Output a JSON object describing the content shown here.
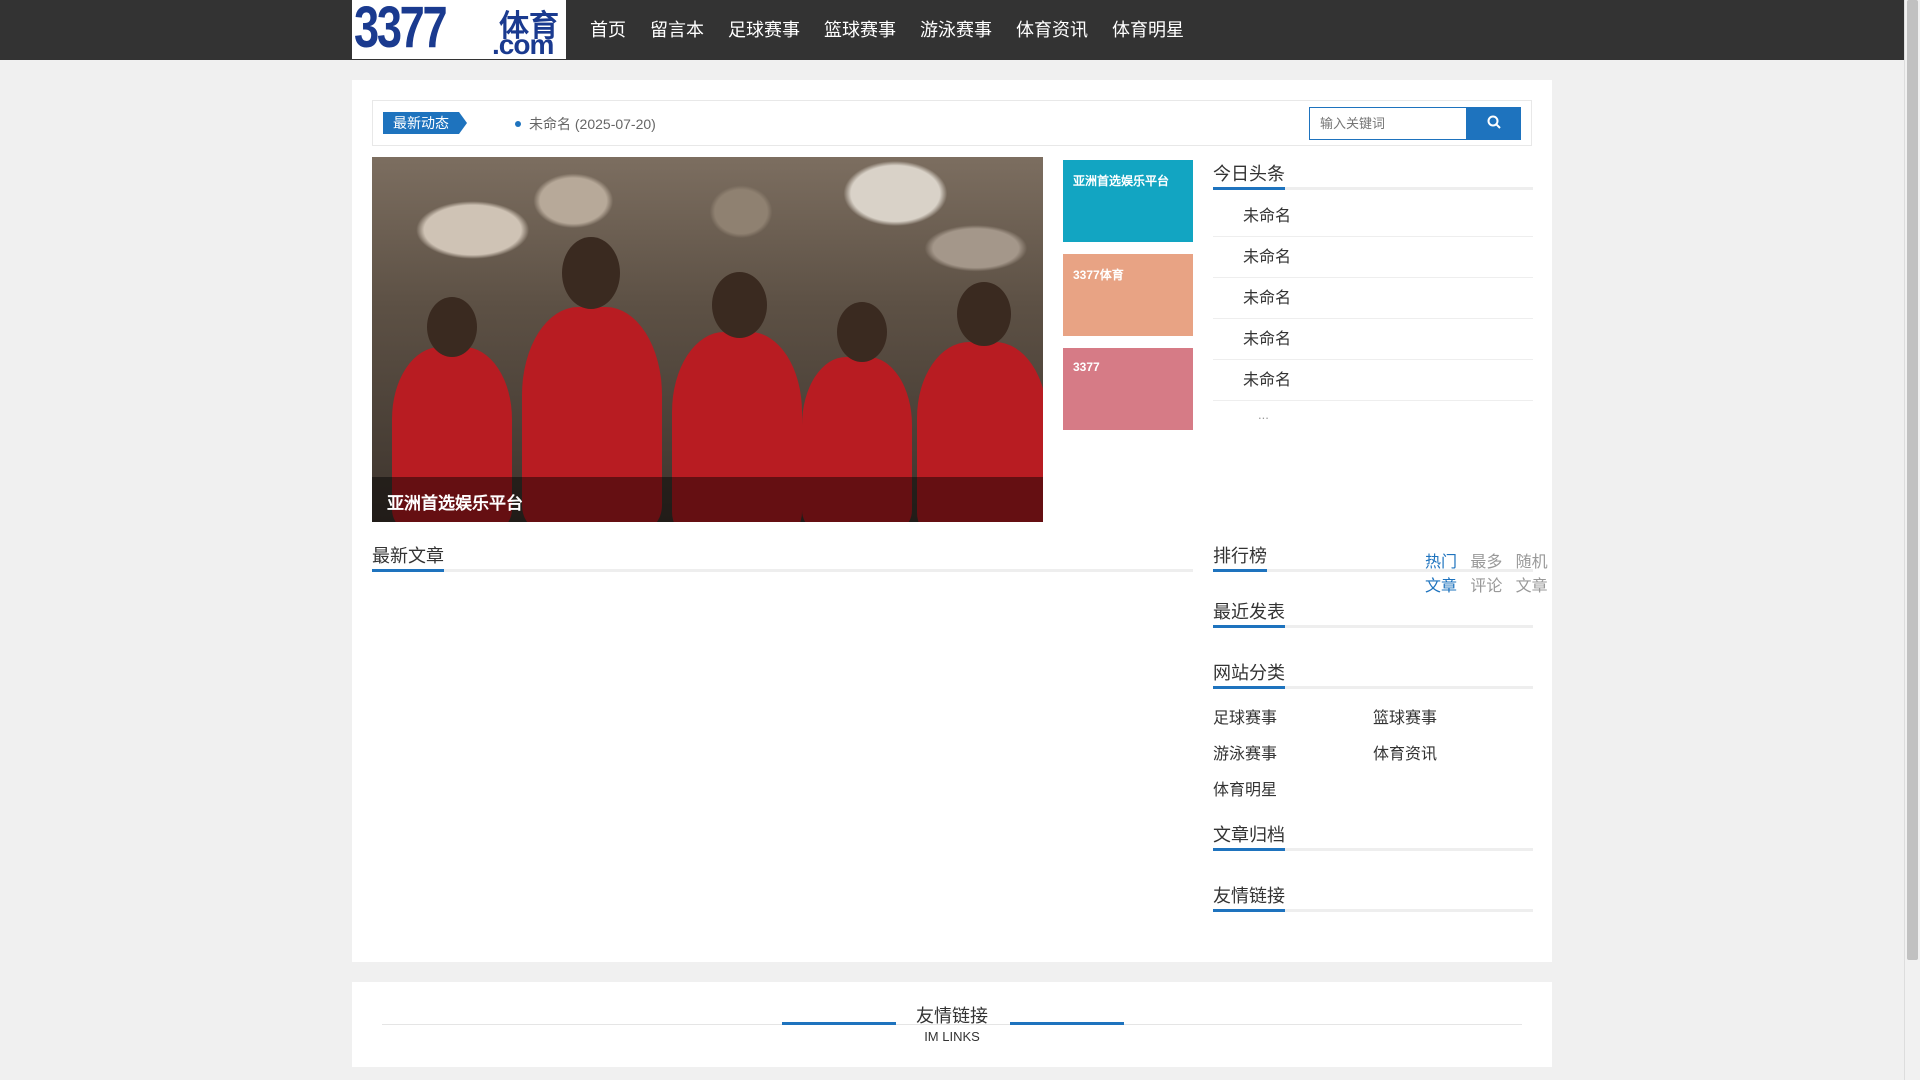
{
  "site": {
    "logo_number": "3377",
    "logo_cn": "体育",
    "logo_com": ".com"
  },
  "nav": [
    "首页",
    "留言本",
    "足球赛事",
    "篮球赛事",
    "游泳赛事",
    "体育资讯",
    "体育明星"
  ],
  "newsbar": {
    "tag": "最新动态",
    "item_title": "未命名",
    "item_date": "(2025-07-20)"
  },
  "search": {
    "placeholder": "输入关键词",
    "button_icon": "search-icon"
  },
  "hero": {
    "caption": "亚洲首选娱乐平台"
  },
  "tiles": [
    "亚洲首选娱乐平台",
    "3377体育",
    "3377"
  ],
  "tile_colors": [
    "#12a5c2",
    "#e8a384",
    "#d67b86"
  ],
  "headlines": {
    "title": "今日头条",
    "items": [
      "未命名",
      "未命名",
      "未命名",
      "未命名",
      "未命名"
    ],
    "more": "..."
  },
  "latest": {
    "title": "最新文章"
  },
  "ranking": {
    "title": "排行榜",
    "tabs": [
      "热门文章",
      "最多评论",
      "随机文章"
    ],
    "active_tab": "热门文章"
  },
  "recent": {
    "title": "最近发表"
  },
  "categories": {
    "title": "网站分类",
    "items": [
      "足球赛事",
      "篮球赛事",
      "游泳赛事",
      "体育资讯",
      "体育明星"
    ]
  },
  "archive": {
    "title": "文章归档"
  },
  "links_side": {
    "title": "友情链接"
  },
  "footer": {
    "title": "友情链接",
    "subtitle": "IM LINKS"
  },
  "colors": {
    "accent": "#1e73be",
    "header_bg": "#333333",
    "page_bg": "#f0f0f0"
  }
}
